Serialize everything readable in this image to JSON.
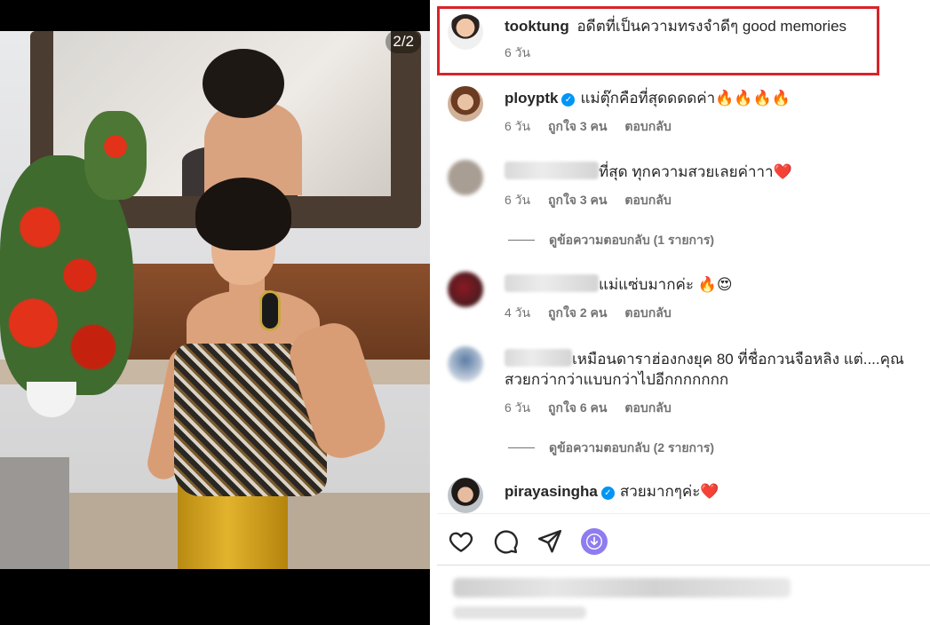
{
  "media": {
    "counter": "2/2"
  },
  "comments": [
    {
      "username": "tooktung",
      "verified": false,
      "text": "อดีตที่เป็นความทรงจำดีๆ good memories",
      "time": "6 วัน",
      "likes": "",
      "reply": "",
      "highlighted": true
    },
    {
      "username": "ployptk",
      "verified": true,
      "text": "แม่ตุ๊กคือที่สุดดดดค่า🔥🔥🔥🔥",
      "time": "6 วัน",
      "likes": "ถูกใจ 3 คน",
      "reply": "ตอบกลับ"
    },
    {
      "username": "",
      "verified": false,
      "text": "ที่สุด ทุกความสวยเลยค่าาา❤️",
      "time": "6 วัน",
      "likes": "ถูกใจ 3 คน",
      "reply": "ตอบกลับ",
      "view_replies": "ดูข้อความตอบกลับ (1 รายการ)"
    },
    {
      "username": "",
      "verified": false,
      "text": "แม่แซ่บมากค่ะ 🔥😍",
      "time": "4 วัน",
      "likes": "ถูกใจ 2 คน",
      "reply": "ตอบกลับ"
    },
    {
      "username": "",
      "verified": false,
      "text": "เหมือนดาราฮ่องกงยุค 80 ที่ชื่อกวนจือหลิง แต่....คุณสวยกว่ากว่าแบบกว่าไปอีกกกกกกก",
      "time": "6 วัน",
      "likes": "ถูกใจ 6 คน",
      "reply": "ตอบกลับ",
      "view_replies": "ดูข้อความตอบกลับ (2 รายการ)"
    },
    {
      "username": "pirayasingha",
      "verified": true,
      "text": "สวยมากๆค่ะ❤️",
      "time": "",
      "likes": "",
      "reply": ""
    }
  ],
  "actions": {
    "like_icon": "heart-icon",
    "comment_icon": "comment-icon",
    "share_icon": "share-icon",
    "download_icon": "download-icon"
  },
  "colors": {
    "highlight_border": "#d8232a",
    "verified_badge": "#0095f6",
    "download_button": "#8e7cf0",
    "muted_text": "#737373"
  }
}
